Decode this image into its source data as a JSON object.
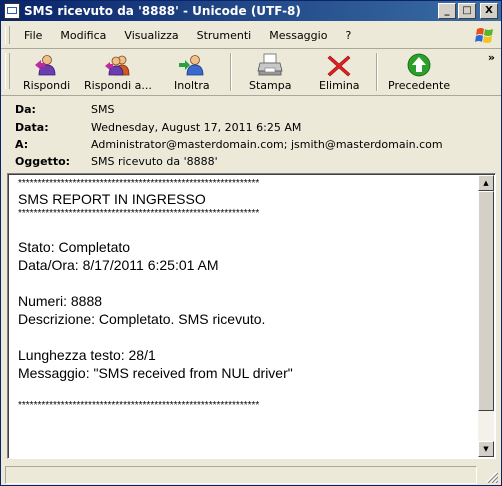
{
  "window": {
    "title": "SMS ricevuto da '8888' - Unicode (UTF-8)"
  },
  "title_buttons": {
    "minimize": "_",
    "maximize": "□",
    "close": "X"
  },
  "menu": [
    "File",
    "Modifica",
    "Visualizza",
    "Strumenti",
    "Messaggio",
    "?"
  ],
  "toolbar": {
    "reply": "Rispondi",
    "reply_all": "Rispondi a...",
    "forward": "Inoltra",
    "print": "Stampa",
    "delete": "Elimina",
    "previous": "Precedente",
    "overflow": "»"
  },
  "headers": {
    "from_label": "Da:",
    "from_value": "SMS",
    "date_label": "Data:",
    "date_value": "Wednesday, August 17, 2011 6:25 AM",
    "to_label": "A:",
    "to_value": "Administrator@masterdomain.com; jsmith@masterdomain.com",
    "subject_label": "Oggetto:",
    "subject_value": "SMS ricevuto da '8888'"
  },
  "body": {
    "stars_top": "**************************************************************",
    "heading": "SMS REPORT IN INGRESSO",
    "stars_mid": "**************************************************************",
    "status": "Stato: Completato",
    "datetime": "Data/Ora: 8/17/2011 6:25:01 AM",
    "numbers": "Numeri: 8888",
    "description": "Descrizione: Completato. SMS ricevuto.",
    "length": "Lunghezza testo: 28/1",
    "message": "Messaggio: \"SMS received from NUL driver\"",
    "stars_bottom": "**************************************************************"
  },
  "scroll": {
    "up": "▲",
    "down": "▼"
  },
  "colors": {
    "titlebar_start": "#0a246a",
    "titlebar_end": "#3a6ea5",
    "chrome": "#ece9d8",
    "delete_red": "#e02020",
    "previous_green": "#2aa02a"
  }
}
